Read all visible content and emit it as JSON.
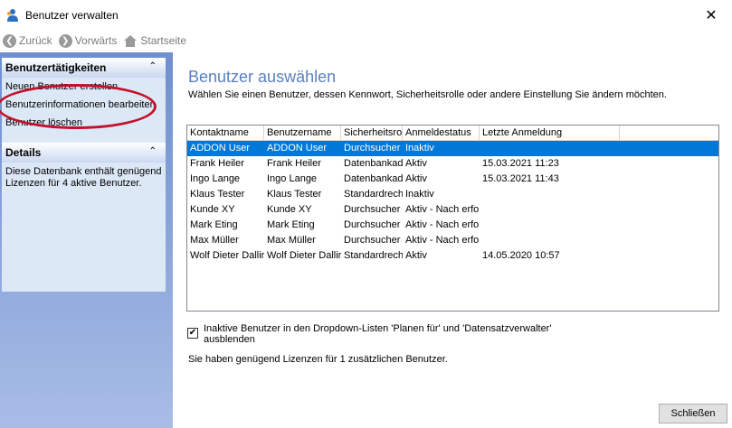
{
  "window": {
    "title": "Benutzer verwalten",
    "close_glyph": "✕"
  },
  "nav": {
    "back": {
      "label": "Zurück",
      "icon": "arrow-left-icon",
      "glyph": "❮"
    },
    "forward": {
      "label": "Vorwärts",
      "icon": "arrow-right-icon",
      "glyph": "❯"
    },
    "home": {
      "label": "Startseite",
      "icon": "home-icon"
    }
  },
  "sidebar": {
    "tasks": {
      "title": "Benutzertätigkeiten",
      "chevron": "⌃",
      "items": [
        {
          "label": "Neuen Benutzer erstellen"
        },
        {
          "label": "Benutzerinformationen bearbeiten"
        },
        {
          "label": "Benutzer löschen"
        }
      ]
    },
    "details": {
      "title": "Details",
      "chevron": "⌃",
      "text": "Diese Datenbank enthält genügend Lizenzen für 4 aktive Benutzer."
    }
  },
  "main": {
    "title": "Benutzer auswählen",
    "subtitle": "Wählen Sie einen Benutzer, dessen Kennwort, Sicherheitsrolle oder andere Einstellung Sie ändern möchten.",
    "table": {
      "columns": [
        "Kontaktname",
        "Benutzername",
        "Sicherheitsrol",
        "Anmeldestatus",
        "Letzte Anmeldung"
      ],
      "rows": [
        [
          "ADDON User",
          "ADDON User",
          "Durchsucher",
          "Inaktiv",
          ""
        ],
        [
          "Frank Heiler",
          "Frank Heiler",
          "Datenbankad",
          "Aktiv",
          "15.03.2021 11:23"
        ],
        [
          "Ingo Lange",
          "Ingo Lange",
          "Datenbankad",
          "Aktiv",
          "15.03.2021 11:43"
        ],
        [
          "Klaus Tester",
          "Klaus Tester",
          "Standardrech",
          "Inaktiv",
          ""
        ],
        [
          "Kunde XY",
          "Kunde XY",
          "Durchsucher",
          "Aktiv - Nach erfo",
          ""
        ],
        [
          "Mark Eting",
          "Mark Eting",
          "Durchsucher",
          "Aktiv - Nach erfo",
          ""
        ],
        [
          "Max Müller",
          "Max Müller",
          "Durchsucher",
          "Aktiv - Nach erfo",
          ""
        ],
        [
          "Wolf Dieter Dallir",
          "Wolf Dieter Dallir",
          "Standardrech",
          "Aktiv",
          "14.05.2020 10:57"
        ]
      ]
    },
    "checkbox": {
      "checked": true,
      "glyph": "✔",
      "label": "Inaktive Benutzer in den Dropdown-Listen 'Planen für' und 'Datensatzverwalter' ausblenden"
    },
    "license_text": "Sie haben genügend Lizenzen für 1 zusätzlichen Benutzer.",
    "close_button": "Schließen"
  },
  "colors": {
    "accent": "#5a7fc2",
    "selection": "#0078d7",
    "highlight_ellipse": "#c4102a"
  }
}
